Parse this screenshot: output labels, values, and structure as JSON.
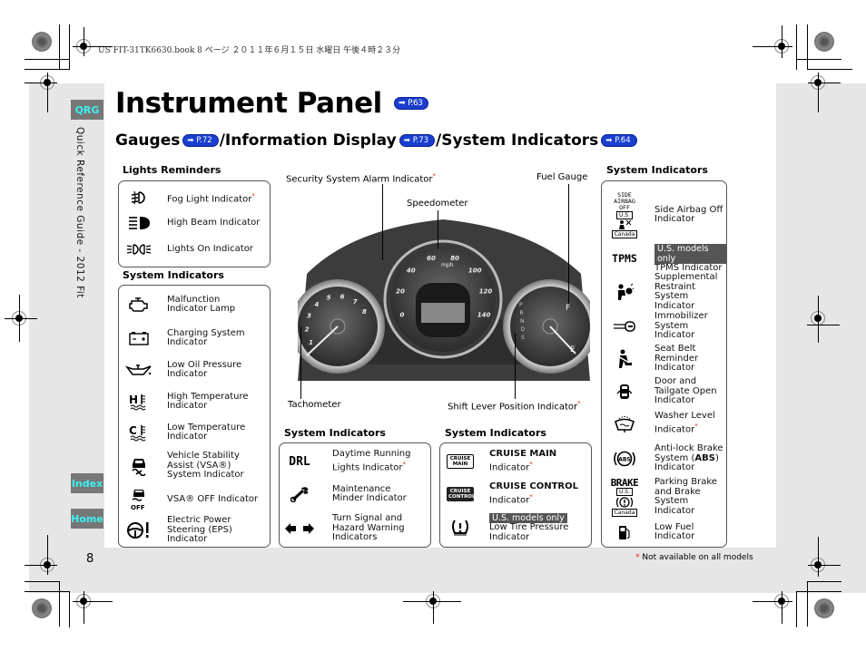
{
  "print_header": "US FIT-31TK6630.book  8 ページ  ２０１１年６月１５日  水曜日  午後４時２３分",
  "sidebar": {
    "qrg_label": "QRG",
    "vertical_title": "Quick Reference Guide - 2012 Fit",
    "index_label": "Index",
    "home_label": "Home"
  },
  "page": {
    "title": "Instrument Panel",
    "title_ref": "P.63",
    "subtitle_parts": [
      {
        "text": "Gauges",
        "ref": "P.72"
      },
      {
        "text": "/Information Display",
        "ref": "P.73"
      },
      {
        "text": "/System Indicators",
        "ref": "P.64"
      }
    ],
    "page_number": "8",
    "footnote_star": "*",
    "footnote": "Not available on all models"
  },
  "lights_reminders": {
    "heading": "Lights Reminders",
    "items": [
      {
        "icon": "fog-light-icon",
        "label": "Fog Light Indicator",
        "star": true
      },
      {
        "icon": "high-beam-icon",
        "label": "High Beam Indicator",
        "star": false
      },
      {
        "icon": "lights-on-icon",
        "label": "Lights On Indicator",
        "star": false
      }
    ]
  },
  "system_left": {
    "heading": "System Indicators",
    "items": [
      {
        "icon": "check-engine-icon",
        "label": "Malfunction Indicator Lamp"
      },
      {
        "icon": "battery-icon",
        "label": "Charging System Indicator"
      },
      {
        "icon": "oil-can-icon",
        "label": "Low Oil Pressure Indicator"
      },
      {
        "icon": "high-temperature-icon",
        "label": "High Temperature Indicator"
      },
      {
        "icon": "low-temperature-icon",
        "label": "Low Temperature Indicator"
      },
      {
        "icon": "vsa-icon",
        "label": "Vehicle Stability Assist (VSA®) System Indicator"
      },
      {
        "icon": "vsa-off-icon",
        "label": "VSA® OFF Indicator"
      },
      {
        "icon": "eps-steering-icon",
        "label": "Electric Power Steering (EPS) Indicator"
      }
    ]
  },
  "system_mid1": {
    "heading": "System Indicators",
    "items": [
      {
        "icon": "drl-icon",
        "icon_text": "DRL",
        "label": "Daytime Running Lights Indicator",
        "star": true
      },
      {
        "icon": "wrench-icon",
        "label": "Maintenance Minder Indicator"
      },
      {
        "icon": "turn-signal-arrows-icon",
        "label": "Turn Signal and Hazard Warning Indicators"
      }
    ]
  },
  "system_mid2": {
    "heading": "System Indicators",
    "items": [
      {
        "icon": "cruise-main-icon",
        "icon_text": "CRUISE MAIN",
        "label_bold": "CRUISE MAIN",
        "label": "Indicator",
        "star": true
      },
      {
        "icon": "cruise-control-icon",
        "icon_text": "CRUISE CONTROL",
        "label_bold": "CRUISE CONTROL",
        "label": "Indicator",
        "star": true
      },
      {
        "icon": "tire-pressure-icon",
        "tag": "U.S. models only",
        "label": "Low Tire Pressure Indicator"
      }
    ]
  },
  "system_right": {
    "heading": "System Indicators",
    "items": [
      {
        "icon": "side-airbag-off-icon",
        "icon_text": "SIDE AIRBAG OFF",
        "tag_us": "U.S.",
        "tag_ca": "Canada",
        "label": "Side Airbag Off Indicator"
      },
      {
        "icon": "tpms-icon",
        "icon_text": "TPMS",
        "tag": "U.S. models only",
        "label": "TPMS Indicator"
      },
      {
        "icon": "srs-airbag-icon",
        "label": "Supplemental Restraint System Indicator"
      },
      {
        "icon": "immobilizer-key-icon",
        "label": "Immobilizer System Indicator"
      },
      {
        "icon": "seat-belt-icon",
        "label": "Seat Belt Reminder Indicator"
      },
      {
        "icon": "door-open-icon",
        "label": "Door and Tailgate Open Indicator"
      },
      {
        "icon": "washer-level-icon",
        "label": "Washer Level Indicator",
        "star": true
      },
      {
        "icon": "abs-icon",
        "label_pre": "Anti-lock Brake System (",
        "label_bold": "ABS",
        "label_post": ") Indicator"
      },
      {
        "icon": "brake-icon",
        "icon_text": "BRAKE",
        "tag_us": "U.S.",
        "tag_ca": "Canada",
        "label": "Parking Brake and Brake System Indicator"
      },
      {
        "icon": "fuel-pump-icon",
        "label": "Low Fuel Indicator"
      }
    ]
  },
  "cluster": {
    "callouts": {
      "security": "Security System Alarm Indicator",
      "speedometer": "Speedometer",
      "fuel_gauge": "Fuel Gauge",
      "tachometer": "Tachometer",
      "shift_lever": "Shift Lever Position Indicator"
    },
    "speed_ticks": [
      "0",
      "20",
      "40",
      "60",
      "80",
      "100",
      "120",
      "140"
    ],
    "speed_unit": "mph",
    "tach_ticks": [
      "1",
      "2",
      "3",
      "4",
      "5",
      "6",
      "7",
      "8"
    ],
    "fuel_labels": [
      "F",
      "E"
    ],
    "shift_letters": [
      "P",
      "R",
      "N",
      "D",
      "S"
    ]
  }
}
